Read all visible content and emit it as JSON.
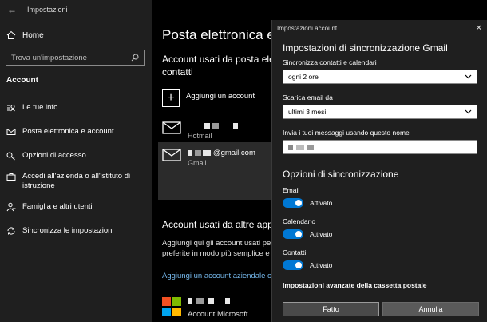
{
  "window": {
    "title": "Impostazioni"
  },
  "sidebar": {
    "home_label": "Home",
    "search_placeholder": "Trova un'impostazione",
    "section_label": "Account",
    "items": [
      {
        "label": "Le tue info",
        "icon": "person-card-icon"
      },
      {
        "label": "Posta elettronica e account",
        "icon": "mail-icon"
      },
      {
        "label": "Opzioni di accesso",
        "icon": "key-icon"
      },
      {
        "label": "Accedi all'azienda o all'istituto di istruzione",
        "icon": "briefcase-icon"
      },
      {
        "label": "Famiglia e altri utenti",
        "icon": "people-icon"
      },
      {
        "label": "Sincronizza le impostazioni",
        "icon": "sync-icon"
      }
    ]
  },
  "main": {
    "title": "Posta elettronica e",
    "email_section_heading": "Account usati da posta ele contatti",
    "add_account_label": "Aggiungi un account",
    "accounts": [
      {
        "name": "",
        "type": "Hotmail"
      },
      {
        "name": "@gmail.com",
        "type": "Gmail"
      }
    ],
    "other_section_heading": "Account usati da altre app",
    "other_section_text_1": "Aggiungi qui gli account usati per",
    "other_section_text_2": "preferite in modo più semplice e v",
    "work_link": "Aggiungi un account aziendale o d",
    "microsoft_account_label": "Account Microsoft"
  },
  "dialog": {
    "title": "Impostazioni account",
    "heading": "Impostazioni di sincronizzazione Gmail",
    "sync_label": "Sincronizza contatti e calendari",
    "sync_value": "ogni 2 ore",
    "download_label": "Scarica email da",
    "download_value": "ultimi 3 mesi",
    "sendname_label": "Invia i tuoi messaggi usando questo nome",
    "sync_options_heading": "Opzioni di sincronizzazione",
    "toggles": [
      {
        "label": "Email",
        "state": "Attivato"
      },
      {
        "label": "Calendario",
        "state": "Attivato"
      },
      {
        "label": "Contatti",
        "state": "Attivato"
      }
    ],
    "advanced_label": "Impostazioni avanzate della cassetta postale",
    "done_label": "Fatto",
    "cancel_label": "Annulla"
  },
  "colors": {
    "accent": "#0078d4",
    "link": "#76b9ed",
    "ms_red": "#f25022",
    "ms_green": "#7fba00",
    "ms_blue": "#00a4ef",
    "ms_yellow": "#ffb900"
  }
}
